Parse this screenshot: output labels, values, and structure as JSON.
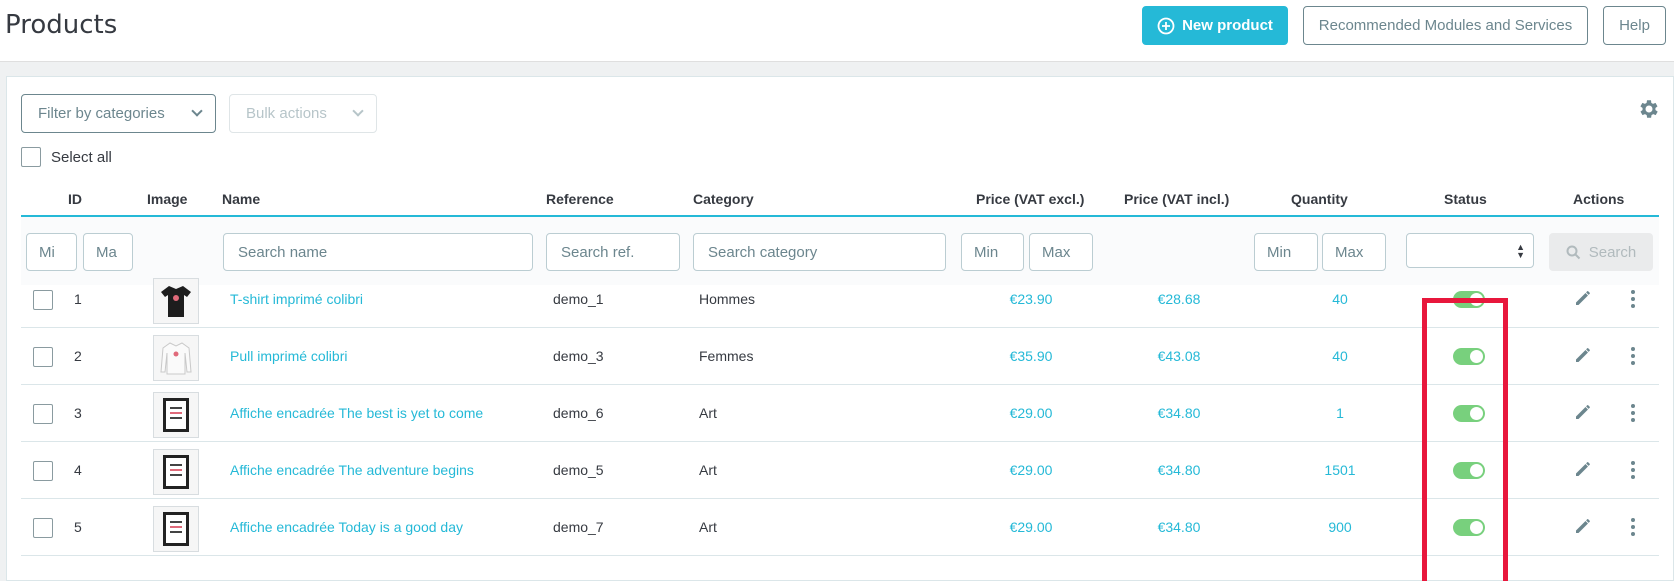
{
  "header": {
    "title": "Products",
    "new_product": "New product",
    "modules": "Recommended Modules and Services",
    "help": "Help"
  },
  "toolbar": {
    "filter_categories": "Filter by categories",
    "bulk_actions": "Bulk actions",
    "select_all": "Select all"
  },
  "columns": {
    "id": "ID",
    "image": "Image",
    "name": "Name",
    "reference": "Reference",
    "category": "Category",
    "price_excl": "Price (VAT excl.)",
    "price_incl": "Price (VAT incl.)",
    "quantity": "Quantity",
    "status": "Status",
    "actions": "Actions"
  },
  "filters": {
    "id_min": "Mi",
    "id_max": "Ma",
    "name": "Search name",
    "reference": "Search ref.",
    "category": "Search category",
    "price_min": "Min",
    "price_max": "Max",
    "qty_min": "Min",
    "qty_max": "Max",
    "search": "Search"
  },
  "products": [
    {
      "id": "1",
      "name": "T-shirt imprimé colibri",
      "reference": "demo_1",
      "category": "Hommes",
      "price_excl": "€23.90",
      "price_incl": "€28.68",
      "quantity": "40",
      "status": true,
      "image": "tshirt-black"
    },
    {
      "id": "2",
      "name": "Pull imprimé colibri",
      "reference": "demo_3",
      "category": "Femmes",
      "price_excl": "€35.90",
      "price_incl": "€43.08",
      "quantity": "40",
      "status": true,
      "image": "sweater-white"
    },
    {
      "id": "3",
      "name": "Affiche encadrée The best is yet to come",
      "reference": "demo_6",
      "category": "Art",
      "price_excl": "€29.00",
      "price_incl": "€34.80",
      "quantity": "1",
      "status": true,
      "image": "framed-poster"
    },
    {
      "id": "4",
      "name": "Affiche encadrée The adventure begins",
      "reference": "demo_5",
      "category": "Art",
      "price_excl": "€29.00",
      "price_incl": "€34.80",
      "quantity": "1501",
      "status": true,
      "image": "framed-poster"
    },
    {
      "id": "5",
      "name": "Affiche encadrée Today is a good day",
      "reference": "demo_7",
      "category": "Art",
      "price_excl": "€29.00",
      "price_incl": "€34.80",
      "quantity": "900",
      "status": true,
      "image": "framed-poster"
    }
  ],
  "colors": {
    "accent": "#25b9d7",
    "toggle_on": "#78d07d",
    "highlight": "#e8173c"
  }
}
